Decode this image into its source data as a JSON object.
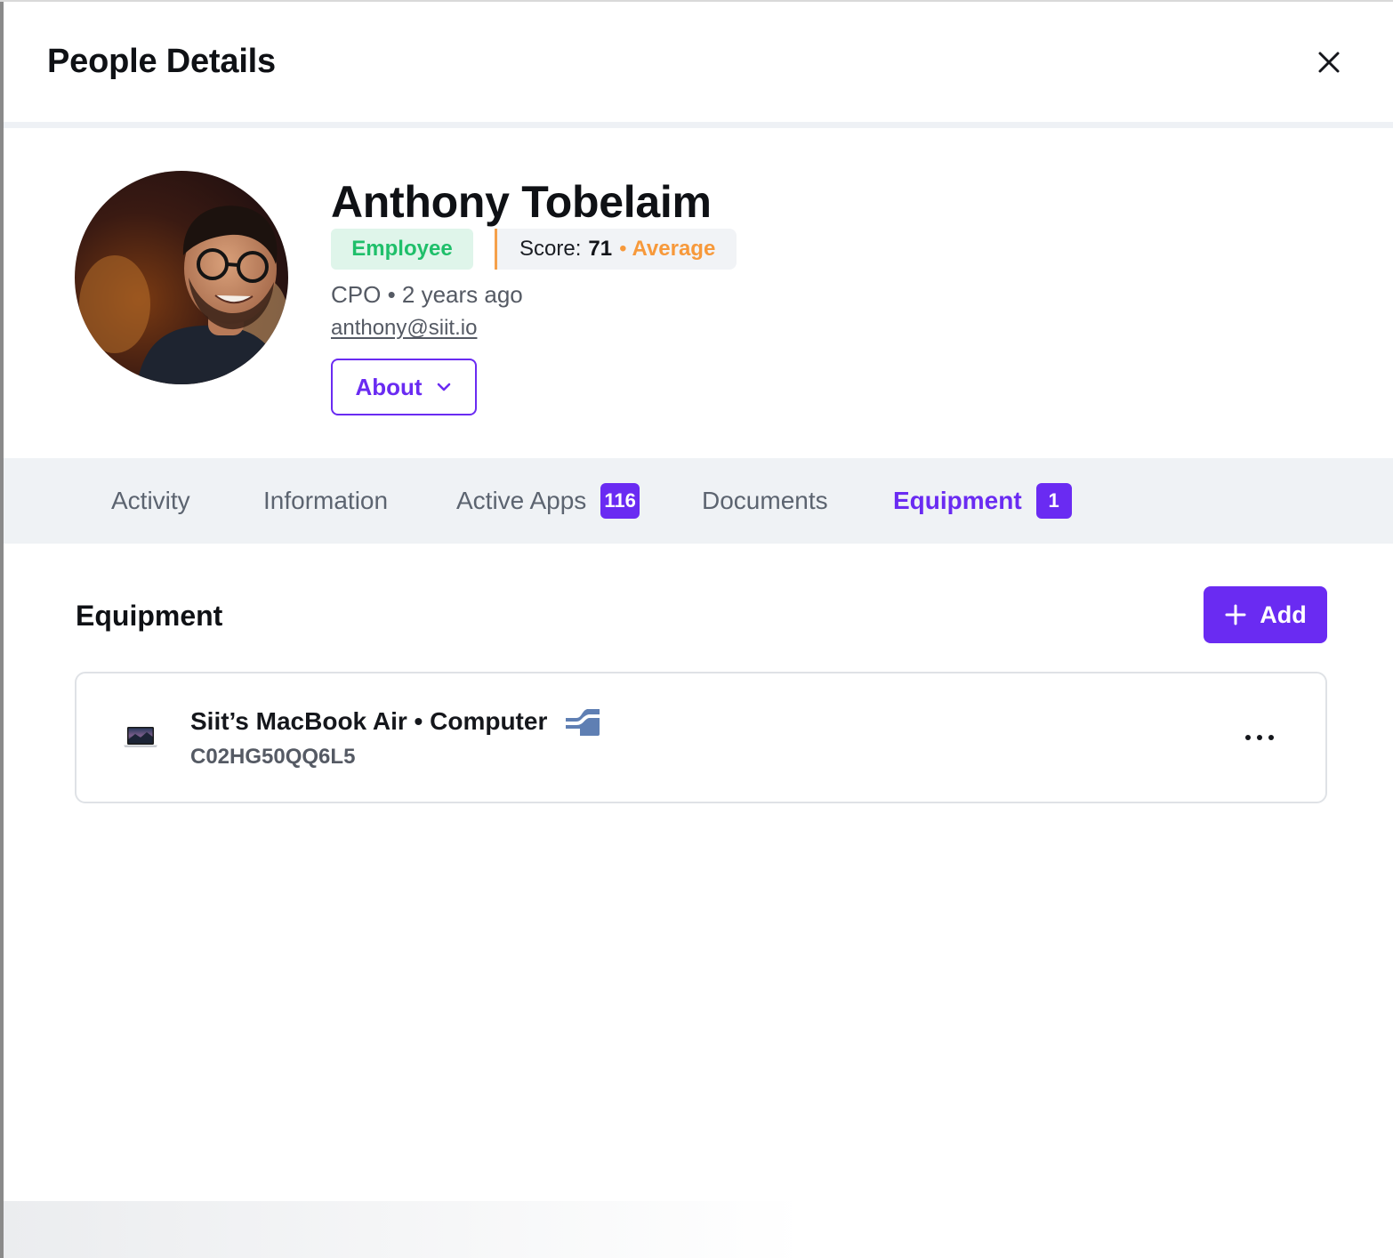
{
  "header": {
    "title": "People Details",
    "close_icon": "close-icon"
  },
  "profile": {
    "name": "Anthony Tobelaim",
    "role_badge": "Employee",
    "score_label": "Score:",
    "score_value": "71",
    "score_separator": "•",
    "score_rating": "Average",
    "meta": "CPO • 2 years ago",
    "email": "anthony@siit.io",
    "about_label": "About",
    "about_icon": "chevron-down-icon"
  },
  "tabs": [
    {
      "label": "Activity"
    },
    {
      "label": "Information"
    },
    {
      "label": "Active Apps",
      "badge": "116"
    },
    {
      "label": "Documents"
    },
    {
      "label": "Equipment",
      "badge": "1",
      "active": true
    }
  ],
  "equipment": {
    "section_title": "Equipment",
    "add_label": "Add",
    "add_icon": "plus-icon",
    "items": [
      {
        "name": "Siit’s MacBook Air • Computer",
        "serial": "C02HG50QQ6L5",
        "device_icon": "laptop-icon",
        "source_icon": "mdm-integration-icon",
        "menu_icon": "more-icon"
      }
    ]
  },
  "colors": {
    "accent": "#6a2bf2",
    "employee_badge_text": "#1fbf6a",
    "employee_badge_bg": "#dff5ea",
    "score_rating": "#f7993b",
    "tabs_bg": "#eff2f5"
  }
}
